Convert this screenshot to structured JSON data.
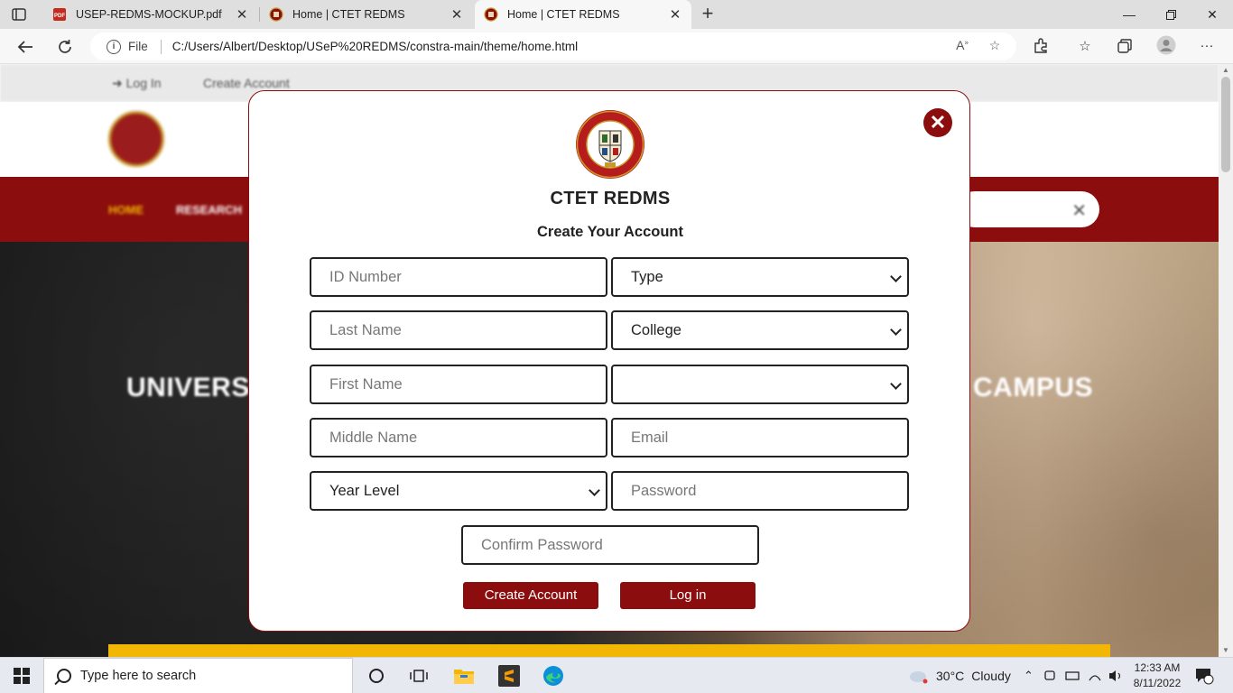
{
  "browser": {
    "tabs": [
      {
        "title": "USEP-REDMS-MOCKUP.pdf",
        "active": false
      },
      {
        "title": "Home | CTET REDMS",
        "active": false
      },
      {
        "title": "Home | CTET REDMS",
        "active": true
      }
    ],
    "address": {
      "scheme_label": "File",
      "url": "C:/Users/Albert/Desktop/USeP%20REDMS/constra-main/theme/home.html"
    }
  },
  "site": {
    "topbar": {
      "login": "Log In",
      "create": "Create Account"
    },
    "nav": {
      "home": "HOME",
      "research": "RESEARCH"
    },
    "hero": {
      "left": "UNIVERS",
      "right": "CAMPUS"
    }
  },
  "modal": {
    "title": "CTET REDMS",
    "subtitle": "Create Your Account",
    "fields": {
      "id_number": "ID Number",
      "type": "Type",
      "last_name": "Last Name",
      "college": "College",
      "first_name": "First Name",
      "program": "",
      "middle_name": "Middle Name",
      "email": "Email",
      "year_level": "Year Level",
      "password": "Password",
      "confirm_password": "Confirm Password"
    },
    "buttons": {
      "create": "Create Account",
      "login": "Log in"
    }
  },
  "taskbar": {
    "search_placeholder": "Type here to search",
    "weather": {
      "temp": "30°C",
      "condition": "Cloudy"
    },
    "time": "12:33 AM",
    "date": "8/11/2022",
    "notification_count": "1"
  },
  "colors": {
    "brand": "#8c0d0d",
    "accent": "#f2b705"
  }
}
